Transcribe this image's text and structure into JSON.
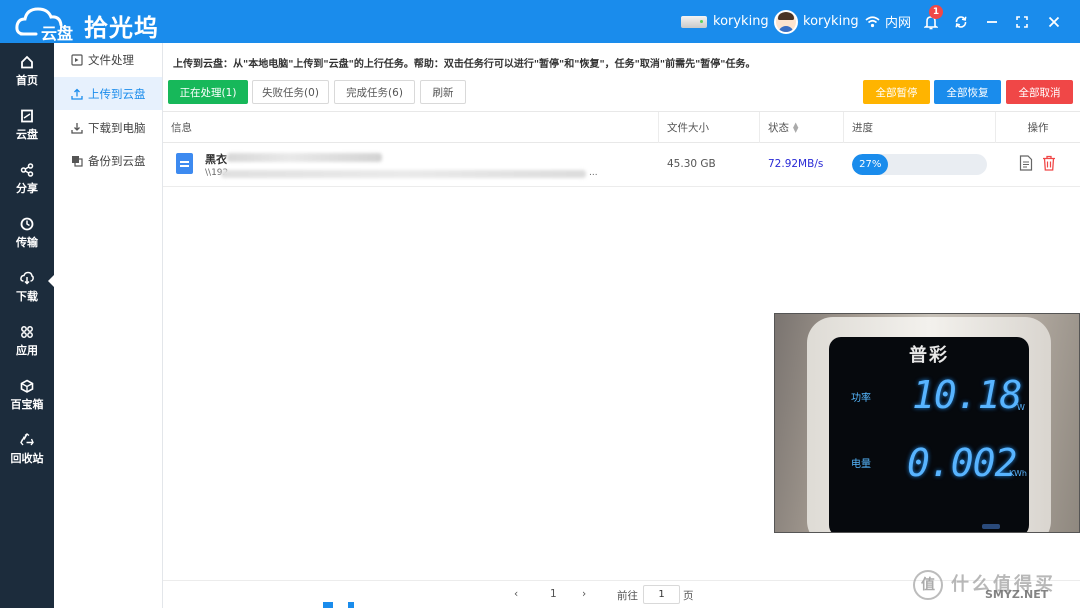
{
  "app": {
    "logo_text": "云盘",
    "brand": "拾光坞"
  },
  "topbar": {
    "disk_label": "koryking",
    "user_name": "koryking",
    "network_label": "内网",
    "notification_count": "1",
    "icons": [
      "disk-icon",
      "avatar",
      "wifi-icon",
      "bell-icon",
      "sync-icon",
      "minimize-icon",
      "maximize-icon",
      "close-icon"
    ]
  },
  "leftnav": {
    "items": [
      {
        "label": "首页",
        "icon": "home-icon"
      },
      {
        "label": "云盘",
        "icon": "cloud-disk-icon"
      },
      {
        "label": "分享",
        "icon": "share-icon"
      },
      {
        "label": "传输",
        "icon": "transfer-icon"
      },
      {
        "label": "下载",
        "icon": "download-icon"
      },
      {
        "label": "应用",
        "icon": "apps-icon"
      },
      {
        "label": "百宝箱",
        "icon": "toolbox-icon"
      },
      {
        "label": "回收站",
        "icon": "recycle-icon"
      }
    ],
    "active": "传输"
  },
  "subnav": {
    "items": [
      {
        "label": "文件处理",
        "icon": "file-process-icon"
      },
      {
        "label": "上传到云盘",
        "icon": "upload-icon"
      },
      {
        "label": "下载到电脑",
        "icon": "download-to-pc-icon"
      },
      {
        "label": "备份到云盘",
        "icon": "backup-icon"
      }
    ],
    "active": "上传到云盘"
  },
  "main": {
    "hint": "上传到云盘：从\"本地电脑\"上传到\"云盘\"的上行任务。帮助：双击任务行可以进行\"暂停\"和\"恢复\"，任务\"取消\"前需先\"暂停\"任务。",
    "tabs": [
      {
        "label": "正在处理(1)"
      },
      {
        "label": "失败任务(0)"
      },
      {
        "label": "完成任务(6)"
      },
      {
        "label": "刷新"
      }
    ],
    "actions": {
      "pause_all": "全部暂停",
      "resume_all": "全部恢复",
      "cancel_all": "全部取消"
    },
    "columns": {
      "info": "信息",
      "size": "文件大小",
      "status": "状态",
      "progress": "进度",
      "operations": "操作"
    },
    "rows": [
      {
        "name_prefix": "黑衣",
        "path_prefix": "\\\\192",
        "path_suffix": "...",
        "size": "45.30 GB",
        "status": "72.92MB/s",
        "progress": 0.27,
        "progress_label": "27%"
      }
    ],
    "pager": {
      "prev": "‹",
      "current": "1",
      "next": "›",
      "goto_label": "前往",
      "goto_value": "1",
      "page_unit": "页"
    }
  },
  "overlay_photo": {
    "brand": "普彩",
    "power_label": "功率",
    "power_value": "10.18",
    "power_unit": "W",
    "energy_label": "电量",
    "energy_value": "0.002",
    "energy_unit": "KWh"
  },
  "watermark": {
    "glyph": "值",
    "text": "什么值得买",
    "site": "SMYZ.NET"
  },
  "colors": {
    "primary": "#1a8cec",
    "sidebar": "#1c2c3c",
    "green": "#17b85a",
    "orange": "#ffb400",
    "red": "#f04747",
    "speed": "#2a2ad6"
  }
}
